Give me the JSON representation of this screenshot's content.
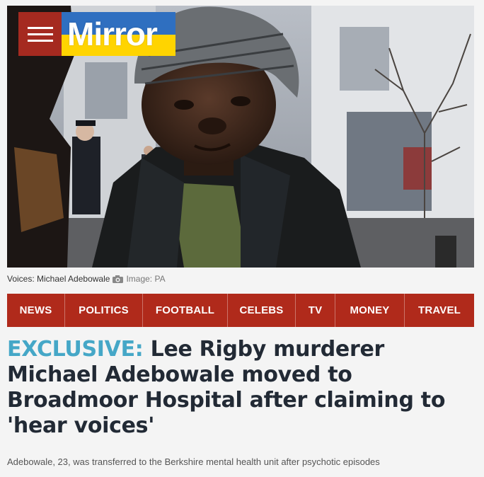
{
  "brand": {
    "menu_icon": "hamburger-menu-icon",
    "logo_text": "Mirror",
    "logo_colors": {
      "top": "#2f6fc0",
      "bottom": "#ffd400",
      "menu_bg": "#a52a20"
    }
  },
  "image": {
    "caption": "Voices: Michael Adebowale",
    "camera_icon": "camera-icon",
    "credit": "Image: PA"
  },
  "nav": {
    "bg_color": "#b02a1b",
    "items": [
      {
        "label": "NEWS"
      },
      {
        "label": "POLITICS"
      },
      {
        "label": "FOOTBALL"
      },
      {
        "label": "CELEBS"
      },
      {
        "label": "TV"
      },
      {
        "label": "MONEY"
      },
      {
        "label": "TRAVEL"
      }
    ]
  },
  "article": {
    "kicker": "EXCLUSIVE:",
    "kicker_color": "#45a7c7",
    "title": "Lee Rigby murderer Michael Adebowale moved to Broadmoor Hospital after claiming to 'hear voices'",
    "standfirst": "Adebowale, 23, was transferred to the Berkshire mental health unit after psychotic episodes"
  }
}
